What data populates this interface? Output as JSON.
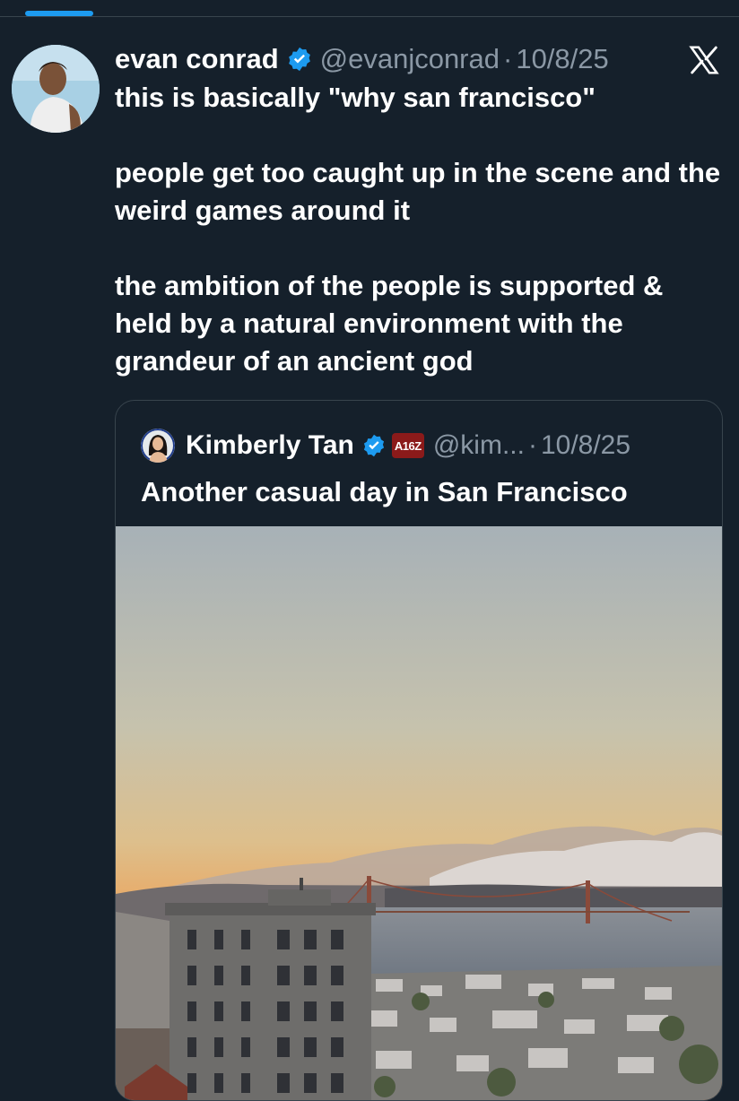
{
  "tweet": {
    "author": {
      "display_name": "evan conrad",
      "handle": "@evanjconrad",
      "verified": true
    },
    "date": "10/8/25",
    "separator": "·",
    "paragraphs": [
      "this is basically \"why san francisco\"",
      "people get too caught up in the scene and the weird games around it",
      "the ambition of the people is supported & held by a natural environment with the grandeur of an ancient god"
    ],
    "brand_icon": "x-logo-icon"
  },
  "quote": {
    "author": {
      "display_name": "Kimberly Tan",
      "handle": "@kim...",
      "verified": true,
      "affiliation_badge": "A16Z"
    },
    "date": "10/8/25",
    "separator": "·",
    "text": "Another casual day in San Francisco",
    "media": "photo-san-francisco-sunset-golden-gate-bridge"
  },
  "colors": {
    "background": "#15202b",
    "text_primary": "#ffffff",
    "text_secondary": "#8b98a5",
    "accent": "#1d9bf0",
    "border": "#38444d",
    "affiliation": "#8b1a1a"
  }
}
